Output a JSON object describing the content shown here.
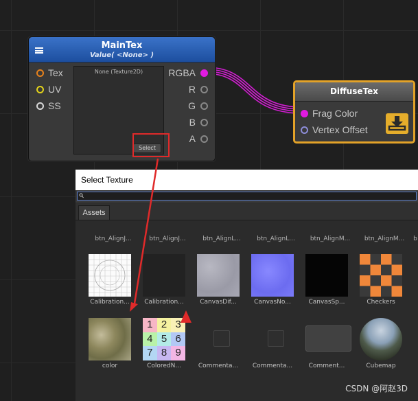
{
  "maintex_node": {
    "title": "MainTex",
    "subtitle": "Value( <None> )",
    "inputs": [
      {
        "label": "Tex",
        "color": "#e8821c"
      },
      {
        "label": "UV",
        "color": "#e3d31a"
      },
      {
        "label": "SS",
        "color": "#d8d8d8"
      }
    ],
    "outputs": [
      {
        "label": "RGBA",
        "color": "#e11be1"
      },
      {
        "label": "R",
        "color": "#8a8a8a"
      },
      {
        "label": "G",
        "color": "#8a8a8a"
      },
      {
        "label": "B",
        "color": "#8a8a8a"
      },
      {
        "label": "A",
        "color": "#8a8a8a"
      }
    ],
    "preview_label": "None (Texture2D)",
    "select_button": "Select",
    "header_color": "#2a5fb4"
  },
  "diffuse_node": {
    "title": "DiffuseTex",
    "inputs": [
      {
        "label": "Frag Color",
        "color": "#e11be1"
      },
      {
        "label": "Vertex Offset",
        "color": "#8d8dd8"
      }
    ],
    "border_color": "#e3a228",
    "icon": "download-icon"
  },
  "picker": {
    "title": "Select Texture",
    "search_placeholder": "",
    "tab": "Assets",
    "header_row": [
      "btn_AlignJ...",
      "btn_AlignJ...",
      "btn_AlignL...",
      "btn_AlignL...",
      "btn_AlignM...",
      "btn_AlignM..."
    ],
    "row1": [
      {
        "label": "Calibration...",
        "thumb": "calibration-grid"
      },
      {
        "label": "Calibration...",
        "thumb": "dark"
      },
      {
        "label": "CanvasDif...",
        "thumb": "noise-grey"
      },
      {
        "label": "CanvasNo...",
        "thumb": "normal-blue"
      },
      {
        "label": "CanvasSp...",
        "thumb": "black"
      },
      {
        "label": "Checkers",
        "thumb": "checker-orange"
      }
    ],
    "row2": [
      {
        "label": "color",
        "thumb": "terrain"
      },
      {
        "label": "ColoredN...",
        "thumb": "numbers"
      },
      {
        "label": "Commenta...",
        "thumb": "small-dark"
      },
      {
        "label": "Commenta...",
        "thumb": "small-dark"
      },
      {
        "label": "Comment...",
        "thumb": "wide-dark"
      },
      {
        "label": "Cubemap",
        "thumb": "sphere"
      }
    ],
    "number_grid": [
      "1",
      "2",
      "3",
      "4",
      "5",
      "6",
      "7",
      "8",
      "9"
    ]
  },
  "watermark": "CSDN @阿赵3D",
  "accent_colors": {
    "annotation_red": "#e02a2a",
    "wire_magenta": "#d21ed2"
  }
}
